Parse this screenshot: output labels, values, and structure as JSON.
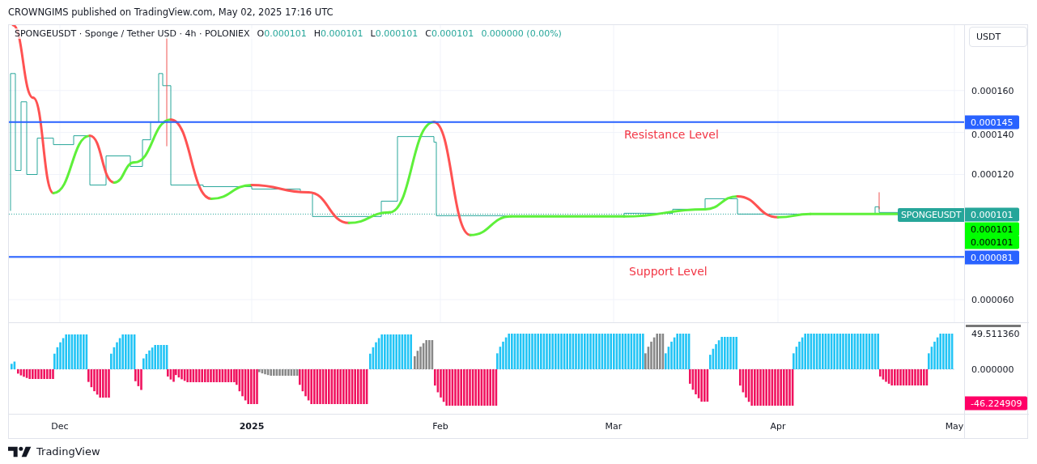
{
  "header": {
    "text": "CROWNGIMS published on TradingView.com, May 02, 2025 17:16 UTC"
  },
  "legend": {
    "symbol": "SPONGEUSDT · Sponge / Tether USD · 4h · POLONIEX",
    "ohlc": [
      {
        "label": "O",
        "value": "0.000101"
      },
      {
        "label": "H",
        "value": "0.000101"
      },
      {
        "label": "L",
        "value": "0.000101"
      },
      {
        "label": "C",
        "value": "0.000101"
      }
    ],
    "change": "0.000000 (0.00%)"
  },
  "currency_button": {
    "label": "USDT"
  },
  "annotations": [
    {
      "text": "Resistance Level"
    },
    {
      "text": "Support Level"
    }
  ],
  "last_price_tag": {
    "label": "SPONGEUSDT"
  },
  "price_scale": [
    {
      "text": "0.000160",
      "kind": "tick"
    },
    {
      "text": "0.000145",
      "kind": "badge",
      "color": "#2962ff"
    },
    {
      "text": "0.000140",
      "kind": "tick"
    },
    {
      "text": "0.000120",
      "kind": "tick"
    },
    {
      "text": "0.000101",
      "kind": "badge",
      "color": "#26a69a"
    },
    {
      "text": "0.000101",
      "kind": "badge",
      "color": "#00ff00"
    },
    {
      "text": "0.000101",
      "kind": "badge",
      "color": "#00ff00"
    },
    {
      "text": "0.000081",
      "kind": "badge",
      "color": "#2962ff"
    },
    {
      "text": "0.000060",
      "kind": "tick"
    }
  ],
  "oscillator_scale": [
    {
      "text": "49.511360",
      "kind": "tick"
    },
    {
      "text": "0.000000",
      "kind": "tick"
    },
    {
      "text": "-46.224909",
      "kind": "badge",
      "color": "#ff0066"
    }
  ],
  "time_axis": [
    {
      "text": "Dec",
      "bold": false
    },
    {
      "text": "2025",
      "bold": true
    },
    {
      "text": "Feb",
      "bold": false
    },
    {
      "text": "Mar",
      "bold": false
    },
    {
      "text": "Apr",
      "bold": false
    },
    {
      "text": "May",
      "bold": false
    }
  ],
  "footer": {
    "brand": "TradingView"
  }
}
